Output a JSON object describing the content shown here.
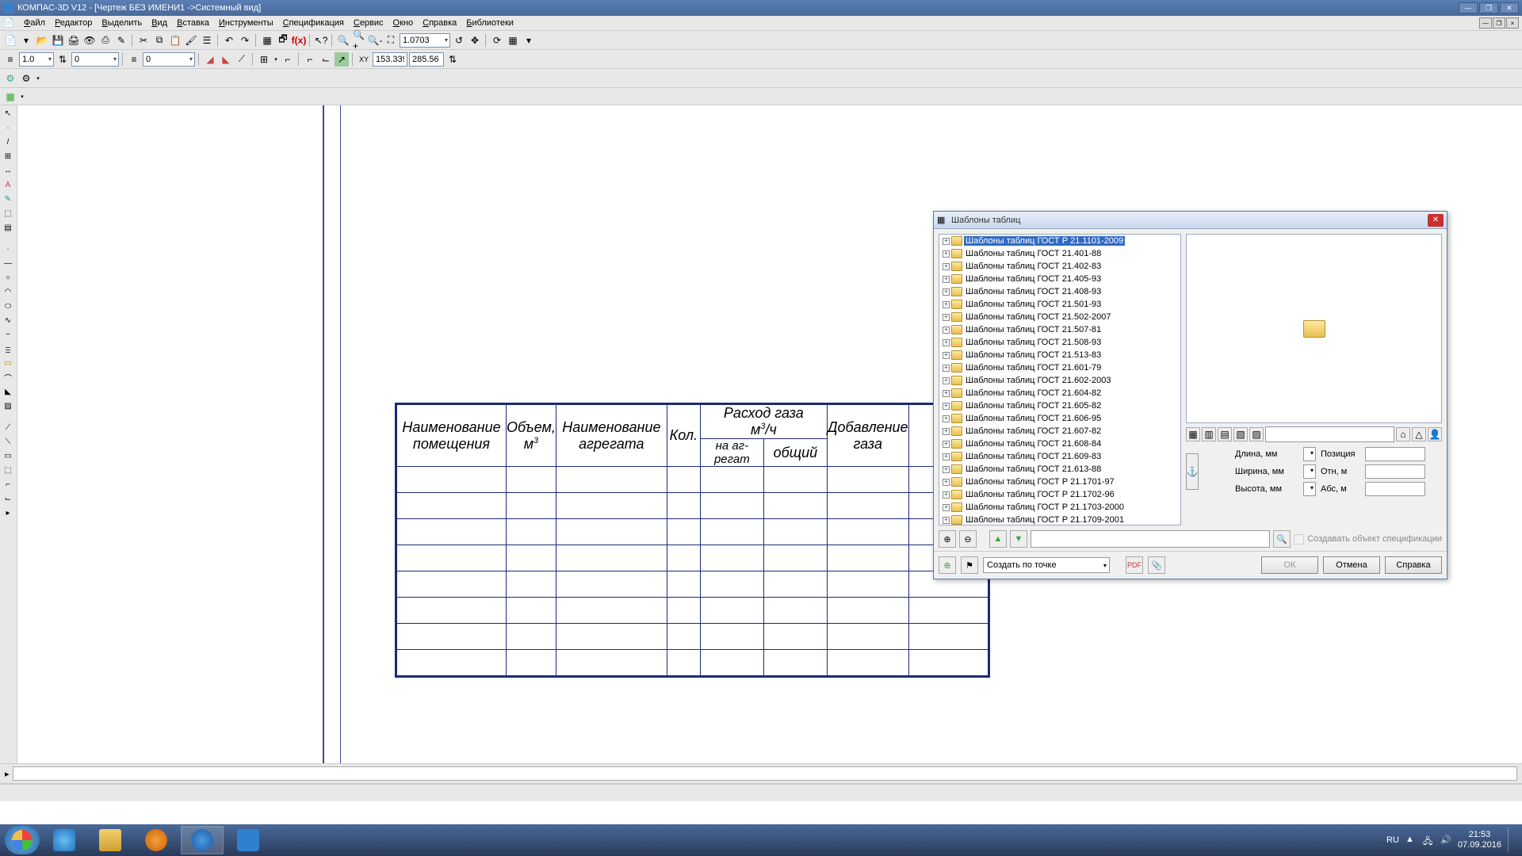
{
  "titlebar": {
    "text": "КОМПАС-3D V12 - [Чертеж БЕЗ ИМЕНИ1 ->Системный вид]"
  },
  "menu": {
    "items": [
      "Файл",
      "Редактор",
      "Выделить",
      "Вид",
      "Вставка",
      "Инструменты",
      "Спецификация",
      "Сервис",
      "Окно",
      "Справка",
      "Библиотеки"
    ]
  },
  "toolbar1": {
    "zoom_value": "1.0703"
  },
  "toolbar2": {
    "field1": "1.0",
    "field2": "0",
    "field3": "0",
    "coord_x": "153.339",
    "coord_y": "285.56"
  },
  "drawing_table": {
    "headers": {
      "col1": "Наименование помещения",
      "col2_l1": "Объем,",
      "col2_l2": "м",
      "col2_sup": "3",
      "col3": "Наименование агрегата",
      "col4": "Кол.",
      "col5": "Расход газа м³/ч",
      "col5a": "на аг- регат",
      "col5b": "общий",
      "col6": "Добавление газа"
    }
  },
  "dialog": {
    "title": "Шаблоны таблиц",
    "tree": [
      {
        "label": "Шаблоны таблиц ГОСТ Р 21.1101-2009",
        "selected": true
      },
      {
        "label": "Шаблоны таблиц ГОСТ 21.401-88"
      },
      {
        "label": "Шаблоны таблиц ГОСТ 21.402-83"
      },
      {
        "label": "Шаблоны таблиц ГОСТ 21.405-93"
      },
      {
        "label": "Шаблоны таблиц ГОСТ 21.408-93"
      },
      {
        "label": "Шаблоны таблиц ГОСТ 21.501-93"
      },
      {
        "label": "Шаблоны таблиц ГОСТ 21.502-2007"
      },
      {
        "label": "Шаблоны таблиц ГОСТ 21.507-81"
      },
      {
        "label": "Шаблоны таблиц ГОСТ 21.508-93"
      },
      {
        "label": "Шаблоны таблиц ГОСТ 21.513-83"
      },
      {
        "label": "Шаблоны таблиц ГОСТ 21.601-79"
      },
      {
        "label": "Шаблоны таблиц ГОСТ 21.602-2003"
      },
      {
        "label": "Шаблоны таблиц ГОСТ 21.604-82"
      },
      {
        "label": "Шаблоны таблиц ГОСТ 21.605-82"
      },
      {
        "label": "Шаблоны таблиц ГОСТ 21.606-95"
      },
      {
        "label": "Шаблоны таблиц ГОСТ 21.607-82"
      },
      {
        "label": "Шаблоны таблиц ГОСТ 21.608-84"
      },
      {
        "label": "Шаблоны таблиц ГОСТ 21.609-83"
      },
      {
        "label": "Шаблоны таблиц ГОСТ 21.613-88"
      },
      {
        "label": "Шаблоны таблиц ГОСТ Р 21.1701-97"
      },
      {
        "label": "Шаблоны таблиц ГОСТ Р 21.1702-96"
      },
      {
        "label": "Шаблоны таблиц ГОСТ Р 21.1703-2000"
      },
      {
        "label": "Шаблоны таблиц ГОСТ Р 21.1709-2001"
      }
    ],
    "params": {
      "length_label": "Длина, мм",
      "width_label": "Ширина, мм",
      "height_label": "Высота, мм",
      "pos_label": "Позиция",
      "otn_label": "Отн, м",
      "abs_label": "Абс, м"
    },
    "spec_checkbox": "Создавать объект спецификации",
    "placement_mode": "Создать по точке",
    "buttons": {
      "ok": "ОК",
      "cancel": "Отмена",
      "help": "Справка"
    }
  },
  "taskbar": {
    "lang": "RU",
    "time": "21:53",
    "date": "07.09.2016"
  }
}
